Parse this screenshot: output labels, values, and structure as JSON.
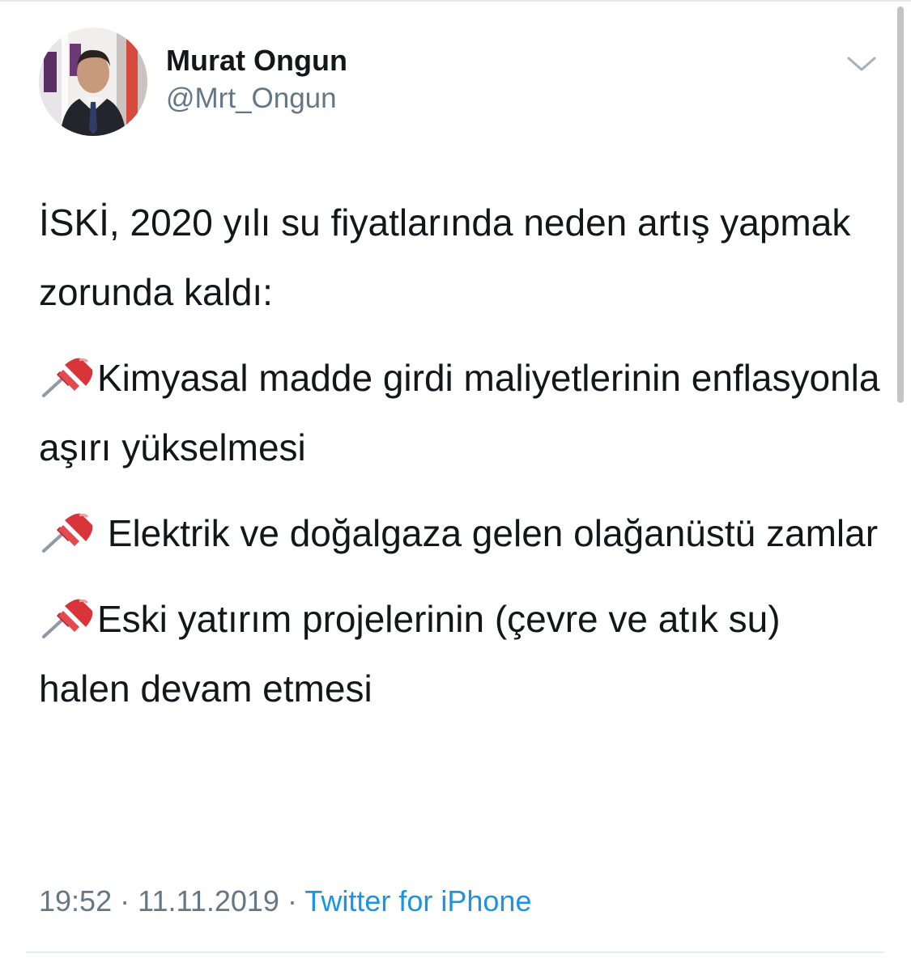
{
  "user": {
    "display_name": "Murat Ongun",
    "handle": "@Mrt_Ongun"
  },
  "tweet": {
    "intro": "İSKİ, 2020 yılı su fiyatlarında neden artış yapmak zorunda kaldı:",
    "points": [
      {
        "icon": "pushpin-icon",
        "text": "Kimyasal madde girdi maliyetlerinin enflasyonla aşırı yükselmesi"
      },
      {
        "icon": "pushpin-icon",
        "text": " Elektrik ve doğalgaza gelen olağanüstü zamlar"
      },
      {
        "icon": "pushpin-icon",
        "text": "Eski yatırım projelerinin (çevre ve atık su) halen devam etmesi"
      }
    ]
  },
  "meta": {
    "time": "19:52",
    "separator": "·",
    "date": "11.11.2019",
    "source": "Twitter for iPhone"
  },
  "colors": {
    "text": "#14171a",
    "secondary": "#657786",
    "link": "#1b95e0",
    "pin": "#d8343a"
  },
  "icons": {
    "menu": "chevron-down-icon"
  }
}
